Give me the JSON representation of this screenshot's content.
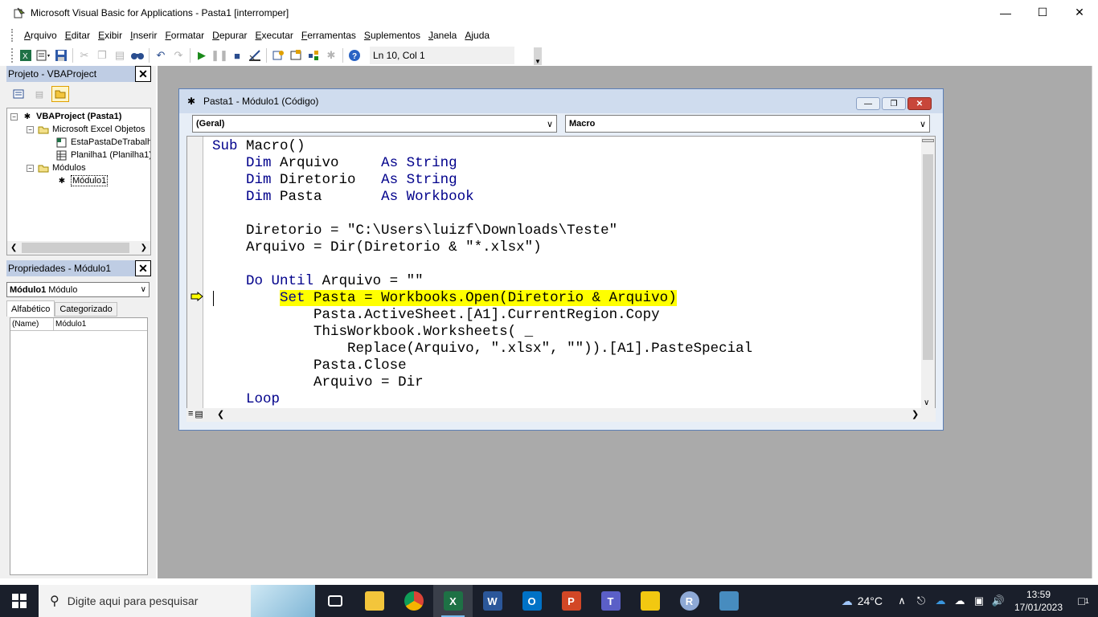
{
  "window": {
    "title": "Microsoft Visual Basic for Applications - Pasta1 [interromper]",
    "icons": [
      "vba-app-icon"
    ],
    "controls": [
      "minimize",
      "maximize",
      "close"
    ]
  },
  "menu": {
    "items": [
      "Arquivo",
      "Editar",
      "Exibir",
      "Inserir",
      "Formatar",
      "Depurar",
      "Executar",
      "Ferramentas",
      "Suplementos",
      "Janela",
      "Ajuda"
    ]
  },
  "toolbar": {
    "cursor_position": "Ln 10, Col 1",
    "buttons": [
      "excel-view-icon",
      "insert-module-icon",
      "save-icon",
      "cut-icon",
      "copy-icon",
      "paste-icon",
      "find-icon",
      "undo-icon",
      "redo-icon",
      "run-icon",
      "break-icon",
      "reset-icon",
      "design-mode-icon",
      "project-explorer-icon",
      "properties-icon",
      "object-browser-icon",
      "toolbox-icon",
      "help-icon"
    ]
  },
  "project_pane": {
    "title": "Projeto - VBAProject",
    "tree": {
      "root": "VBAProject (Pasta1)",
      "folder_objects": "Microsoft Excel Objetos",
      "workbook": "EstaPastaDeTrabalh",
      "sheet": "Planilha1 (Planilha1)",
      "folder_modules": "Módulos",
      "module": "Módulo1"
    }
  },
  "properties_pane": {
    "title": "Propriedades - Módulo1",
    "object_name": "Módulo1",
    "object_type": "Módulo",
    "tabs": [
      "Alfabético",
      "Categorizado"
    ],
    "rows": [
      {
        "key": "(Name)",
        "value": "Módulo1"
      }
    ]
  },
  "code_window": {
    "title": "Pasta1 - Módulo1 (Código)",
    "object_combo": "(Geral)",
    "procedure_combo": "Macro",
    "execution_line": 10,
    "lines": [
      "Sub Macro()",
      "    Dim Arquivo     As String",
      "    Dim Diretorio   As String",
      "    Dim Pasta       As Workbook",
      "",
      "    Diretorio = \"C:\\Users\\luizf\\Downloads\\Teste\"",
      "    Arquivo = Dir(Diretorio & \"*.xlsx\")",
      "",
      "    Do Until Arquivo = \"\"",
      "        Set Pasta = Workbooks.Open(Diretorio & Arquivo)",
      "            Pasta.ActiveSheet.[A1].CurrentRegion.Copy",
      "            ThisWorkbook.Worksheets( _",
      "                Replace(Arquivo, \".xlsx\", \"\")).[A1].PasteSpecial",
      "            Pasta.Close",
      "            Arquivo = Dir",
      "    Loop"
    ]
  },
  "taskbar": {
    "search_placeholder": "Digite aqui para pesquisar",
    "apps": [
      "task-view",
      "file-explorer",
      "chrome",
      "excel",
      "word",
      "outlook",
      "powerpoint",
      "teams",
      "power-bi",
      "r",
      "godot"
    ],
    "weather": "24°C",
    "time": "13:59",
    "date": "17/01/2023",
    "notifications": "1"
  }
}
